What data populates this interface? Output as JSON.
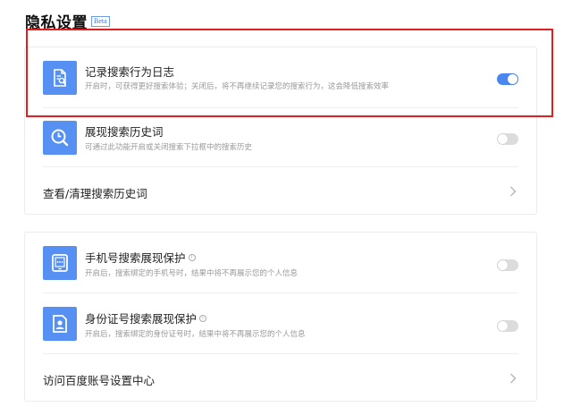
{
  "page": {
    "title": "隐私设置",
    "badge": "Beta"
  },
  "colors": {
    "accent": "#4a86f0",
    "icon_bg": "#5590f2",
    "highlight": "#e02020"
  },
  "section1": {
    "items": [
      {
        "icon": "search-log-icon",
        "title": "记录搜索行为日志",
        "desc": "开启时，可获得更好搜索体验；关闭后，将不再继续记录您的搜索行为，这会降低搜索效率",
        "toggle_on": true
      },
      {
        "icon": "clock-search-icon",
        "title": "展现搜索历史词",
        "desc": "可通过此功能开启或关闭搜索下拉框中的搜索历史",
        "toggle_on": false
      }
    ],
    "link": {
      "label": "查看/清理搜索历史词"
    }
  },
  "section2": {
    "items": [
      {
        "icon": "phone-icon",
        "title": "手机号搜索展现保护",
        "info": "i",
        "desc": "开启后，搜索绑定的手机号时，结果中将不再展示您的个人信息",
        "toggle_on": false
      },
      {
        "icon": "id-card-icon",
        "title": "身份证号搜索展现保护",
        "info": "i",
        "desc": "开启后，搜索绑定的身份证号时，结果中将不再展示您的个人信息",
        "toggle_on": false
      }
    ],
    "link": {
      "label": "访问百度账号设置中心"
    }
  }
}
